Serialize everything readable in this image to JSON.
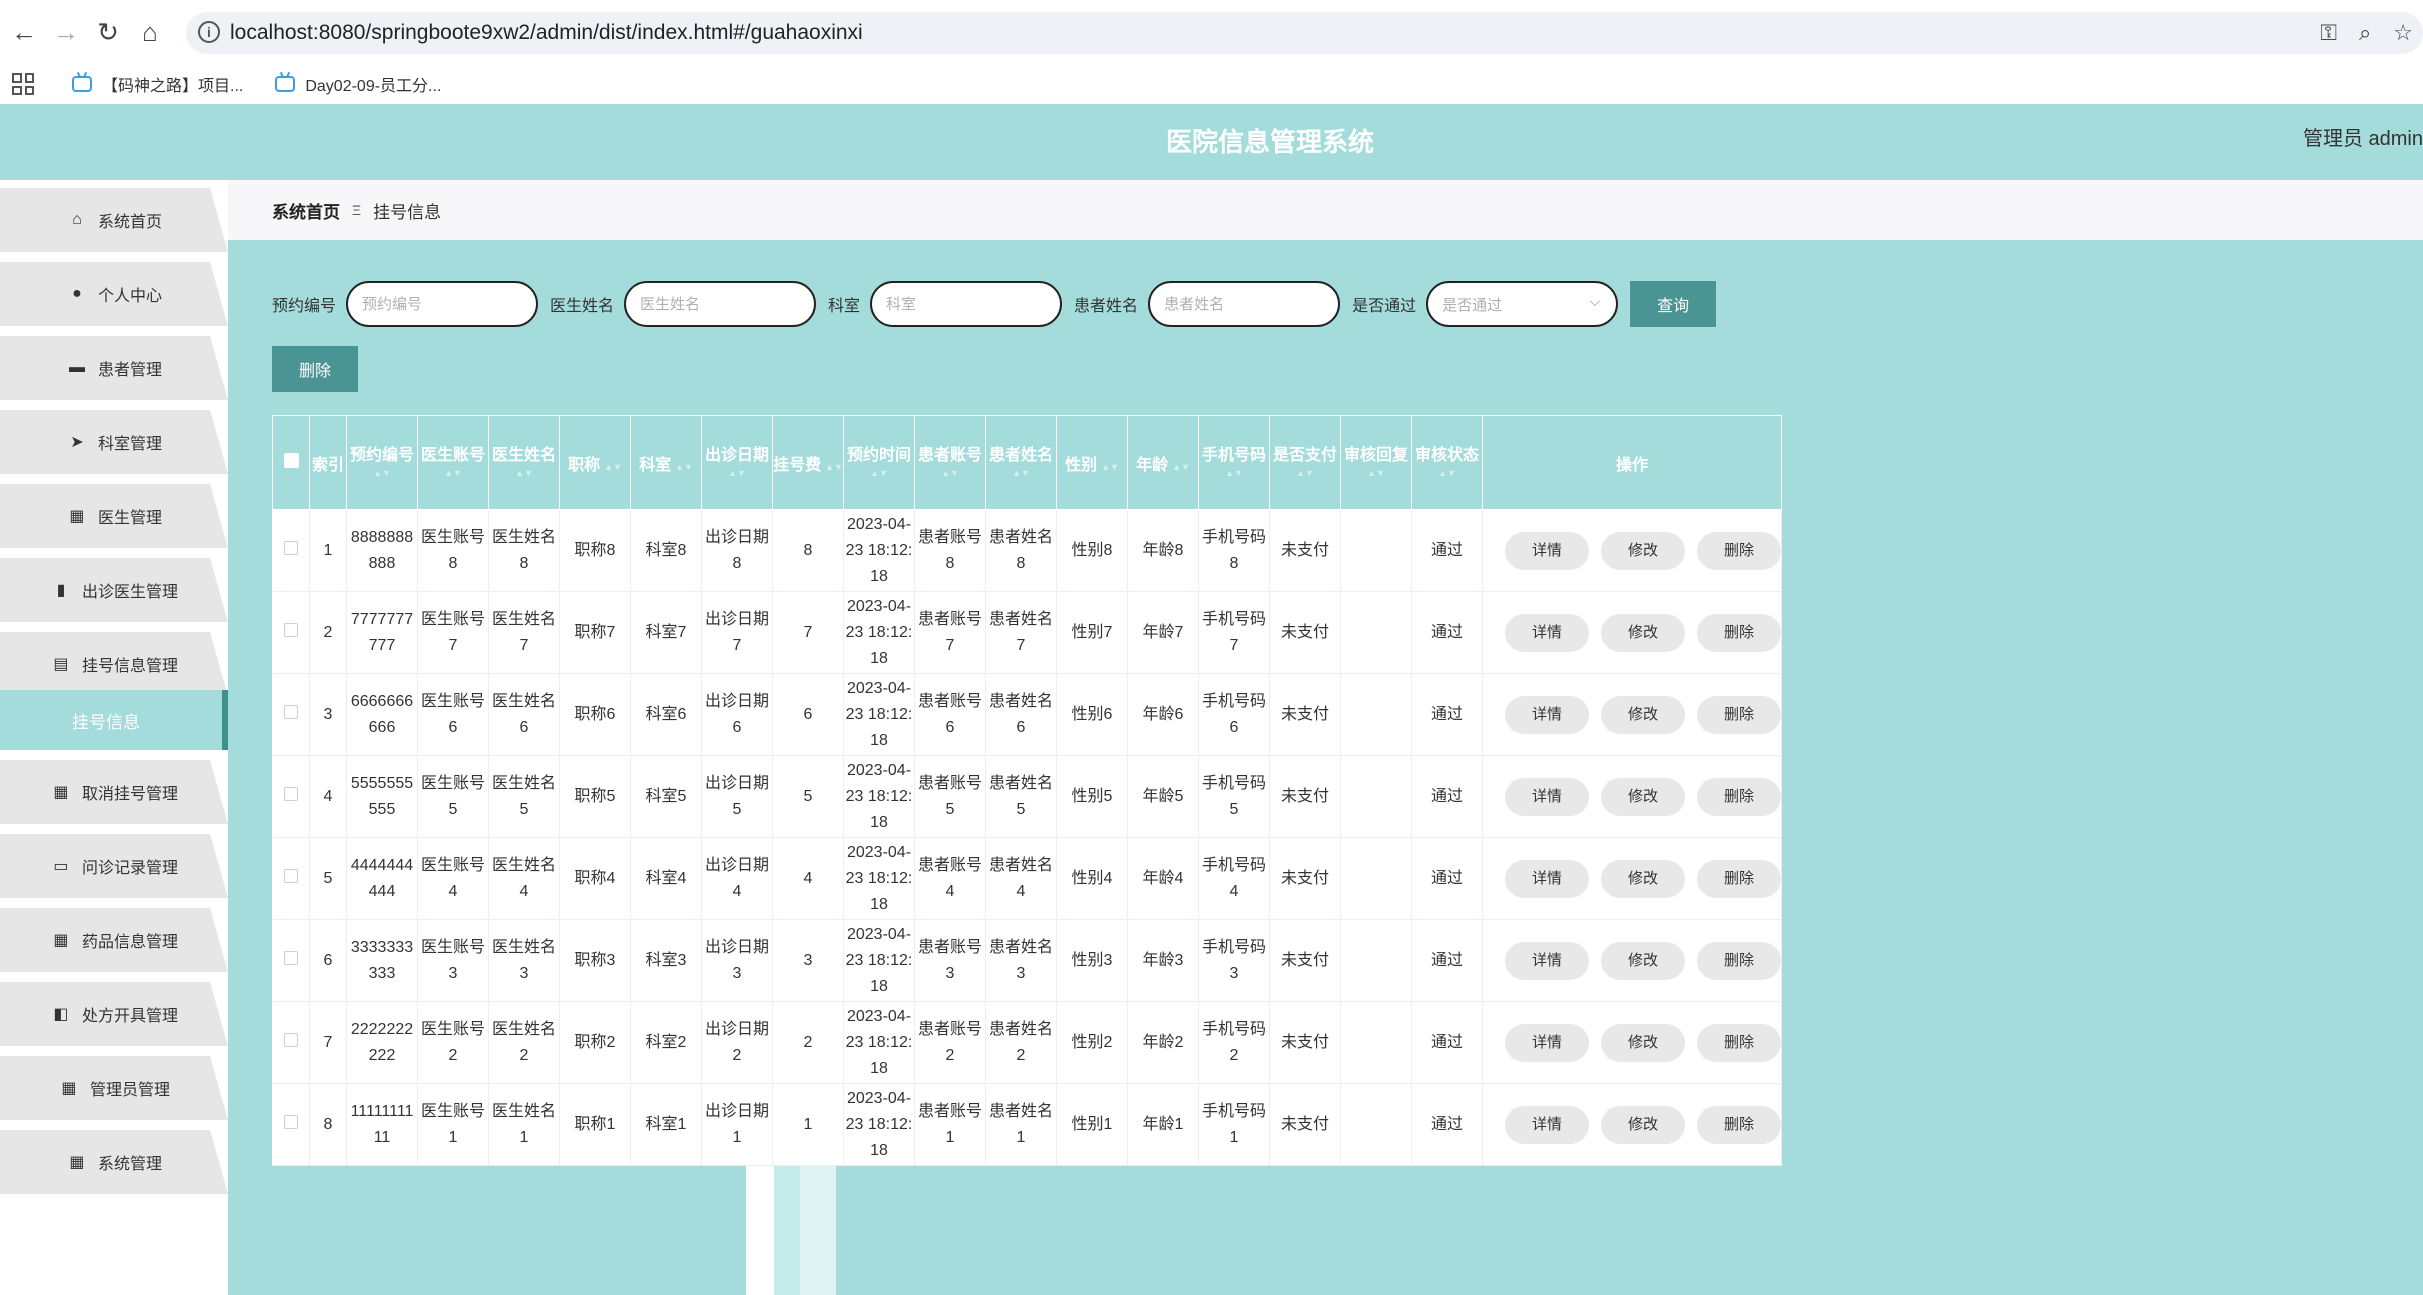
{
  "browser": {
    "url": "localhost:8080/springboote9xw2/admin/dist/index.html#/guahaoxinxi",
    "bookmarks": [
      "【码神之路】项目...",
      "Day02-09-员工分..."
    ]
  },
  "header": {
    "title": "医院信息管理系统",
    "user": "管理员 admin"
  },
  "sidebar": {
    "items": [
      {
        "label": "系统首页",
        "icon": "home-icon"
      },
      {
        "label": "个人中心",
        "icon": "user-icon"
      },
      {
        "label": "患者管理",
        "icon": "briefcase-icon"
      },
      {
        "label": "科室管理",
        "icon": "send-icon"
      },
      {
        "label": "医生管理",
        "icon": "grid-icon"
      },
      {
        "label": "出诊医生管理",
        "icon": "bar-chart-icon"
      },
      {
        "label": "挂号信息管理",
        "icon": "clipboard-icon"
      },
      {
        "label": "取消挂号管理",
        "icon": "grid-icon"
      },
      {
        "label": "问诊记录管理",
        "icon": "monitor-icon"
      },
      {
        "label": "药品信息管理",
        "icon": "grid-icon"
      },
      {
        "label": "处方开具管理",
        "icon": "ticket-icon"
      },
      {
        "label": "管理员管理",
        "icon": "grid-icon"
      },
      {
        "label": "系统管理",
        "icon": "grid-icon"
      }
    ],
    "active_sub": "挂号信息"
  },
  "breadcrumb": {
    "home": "系统首页",
    "separator": "Ξ",
    "current": "挂号信息"
  },
  "search": {
    "fields": [
      {
        "label": "预约编号",
        "placeholder": "预约编号"
      },
      {
        "label": "医生姓名",
        "placeholder": "医生姓名"
      },
      {
        "label": "科室",
        "placeholder": "科室"
      },
      {
        "label": "患者姓名",
        "placeholder": "患者姓名"
      }
    ],
    "select_label": "是否通过",
    "select_placeholder": "是否通过",
    "query_button": "查询",
    "delete_button": "删除"
  },
  "table": {
    "columns": [
      "索引",
      "预约编号",
      "医生账号",
      "医生姓名",
      "职称",
      "科室",
      "出诊日期",
      "挂号费",
      "预约时间",
      "患者账号",
      "患者姓名",
      "性别",
      "年龄",
      "手机号码",
      "是否支付",
      "审核回复",
      "审核状态",
      "操作"
    ],
    "rows": [
      {
        "index": "1",
        "code": "8888888888",
        "doc_account": "医生账号8",
        "doc_name": "医生姓名8",
        "title": "职称8",
        "dept": "科室8",
        "date": "出诊日期8",
        "fee": "8",
        "time": "2023-04-23 18:12:18",
        "pat_account": "患者账号8",
        "pat_name": "患者姓名8",
        "gender": "性别8",
        "age": "年龄8",
        "phone": "手机号码8",
        "paid": "未支付",
        "reply": "",
        "status": "通过"
      },
      {
        "index": "2",
        "code": "7777777777",
        "doc_account": "医生账号7",
        "doc_name": "医生姓名7",
        "title": "职称7",
        "dept": "科室7",
        "date": "出诊日期7",
        "fee": "7",
        "time": "2023-04-23 18:12:18",
        "pat_account": "患者账号7",
        "pat_name": "患者姓名7",
        "gender": "性别7",
        "age": "年龄7",
        "phone": "手机号码7",
        "paid": "未支付",
        "reply": "",
        "status": "通过"
      },
      {
        "index": "3",
        "code": "6666666666",
        "doc_account": "医生账号6",
        "doc_name": "医生姓名6",
        "title": "职称6",
        "dept": "科室6",
        "date": "出诊日期6",
        "fee": "6",
        "time": "2023-04-23 18:12:18",
        "pat_account": "患者账号6",
        "pat_name": "患者姓名6",
        "gender": "性别6",
        "age": "年龄6",
        "phone": "手机号码6",
        "paid": "未支付",
        "reply": "",
        "status": "通过"
      },
      {
        "index": "4",
        "code": "5555555555",
        "doc_account": "医生账号5",
        "doc_name": "医生姓名5",
        "title": "职称5",
        "dept": "科室5",
        "date": "出诊日期5",
        "fee": "5",
        "time": "2023-04-23 18:12:18",
        "pat_account": "患者账号5",
        "pat_name": "患者姓名5",
        "gender": "性别5",
        "age": "年龄5",
        "phone": "手机号码5",
        "paid": "未支付",
        "reply": "",
        "status": "通过"
      },
      {
        "index": "5",
        "code": "4444444444",
        "doc_account": "医生账号4",
        "doc_name": "医生姓名4",
        "title": "职称4",
        "dept": "科室4",
        "date": "出诊日期4",
        "fee": "4",
        "time": "2023-04-23 18:12:18",
        "pat_account": "患者账号4",
        "pat_name": "患者姓名4",
        "gender": "性别4",
        "age": "年龄4",
        "phone": "手机号码4",
        "paid": "未支付",
        "reply": "",
        "status": "通过"
      },
      {
        "index": "6",
        "code": "3333333333",
        "doc_account": "医生账号3",
        "doc_name": "医生姓名3",
        "title": "职称3",
        "dept": "科室3",
        "date": "出诊日期3",
        "fee": "3",
        "time": "2023-04-23 18:12:18",
        "pat_account": "患者账号3",
        "pat_name": "患者姓名3",
        "gender": "性别3",
        "age": "年龄3",
        "phone": "手机号码3",
        "paid": "未支付",
        "reply": "",
        "status": "通过"
      },
      {
        "index": "7",
        "code": "2222222222",
        "doc_account": "医生账号2",
        "doc_name": "医生姓名2",
        "title": "职称2",
        "dept": "科室2",
        "date": "出诊日期2",
        "fee": "2",
        "time": "2023-04-23 18:12:18",
        "pat_account": "患者账号2",
        "pat_name": "患者姓名2",
        "gender": "性别2",
        "age": "年龄2",
        "phone": "手机号码2",
        "paid": "未支付",
        "reply": "",
        "status": "通过"
      },
      {
        "index": "8",
        "code": "1111111111",
        "doc_account": "医生账号1",
        "doc_name": "医生姓名1",
        "title": "职称1",
        "dept": "科室1",
        "date": "出诊日期1",
        "fee": "1",
        "time": "2023-04-23 18:12:18",
        "pat_account": "患者账号1",
        "pat_name": "患者姓名1",
        "gender": "性别1",
        "age": "年龄1",
        "phone": "手机号码1",
        "paid": "未支付",
        "reply": "",
        "status": "通过"
      }
    ],
    "row_actions": [
      "详情",
      "修改",
      "删除"
    ]
  },
  "colors": {
    "theme": "#a4dcdc",
    "button": "#4a9494",
    "menu_bg": "#e6e6e6"
  }
}
